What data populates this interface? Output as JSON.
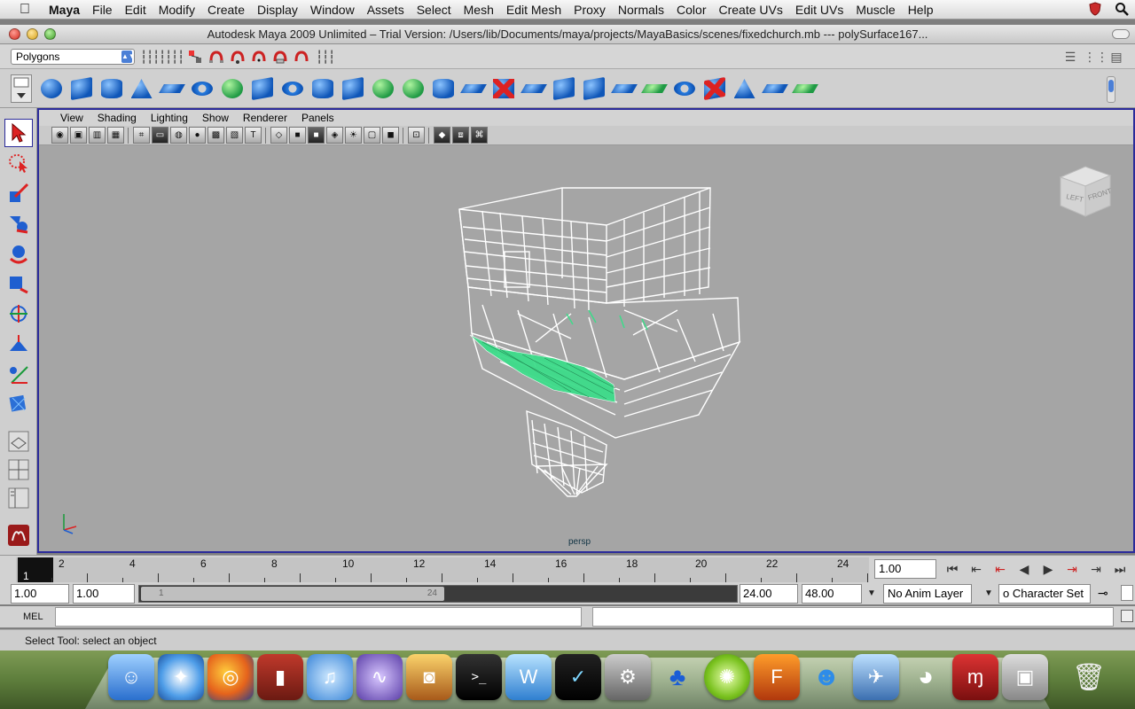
{
  "menubar": {
    "app": "Maya",
    "items": [
      "File",
      "Edit",
      "Modify",
      "Create",
      "Display",
      "Window",
      "Assets",
      "Select",
      "Mesh",
      "Edit Mesh",
      "Proxy",
      "Normals",
      "Color",
      "Create UVs",
      "Edit UVs",
      "Muscle",
      "Help"
    ]
  },
  "window": {
    "title": "Autodesk Maya 2009 Unlimited – Trial Version: /Users/lib/Documents/maya/projects/MayaBasics/scenes/fixedchurch.mb   ---   polySurface167..."
  },
  "statusline": {
    "menu_set": "Polygons"
  },
  "shelf": {
    "icons": [
      "poly-sphere-icon",
      "poly-cube-icon",
      "poly-cylinder-icon",
      "poly-cone-icon",
      "poly-plane-icon",
      "poly-torus-icon",
      "combine-icon",
      "separate-icon",
      "smooth-icon",
      "extrude-icon",
      "bridge-icon",
      "append-icon",
      "split-icon",
      "insert-edge-loop-icon",
      "offset-edge-loop-icon",
      "bevel-icon",
      "delete-edge-icon",
      "extract-icon",
      "merge-icon",
      "wedge-icon",
      "keep-faces-icon",
      "mirror-icon",
      "uv-editor-icon",
      "sculpt-icon",
      "plane-snap-icon",
      "quad-draw-icon"
    ]
  },
  "panel": {
    "menu": [
      "View",
      "Shading",
      "Lighting",
      "Show",
      "Renderer",
      "Panels"
    ],
    "camera_label": "persp",
    "viewcube": {
      "left": "LEFT",
      "front": "FRONT"
    }
  },
  "timeline": {
    "current_frame": "1",
    "labels": [
      "2",
      "4",
      "6",
      "8",
      "10",
      "12",
      "14",
      "16",
      "18",
      "20",
      "22",
      "24"
    ],
    "current_time": "1.00"
  },
  "range": {
    "start_time": "1.00",
    "playback_start": "1.00",
    "handle_start": "1",
    "handle_end": "24",
    "playback_end": "24.00",
    "end_time": "48.00",
    "anim_layer": "No Anim Layer",
    "character_set": "o Character Set"
  },
  "cmdline": {
    "label": "MEL"
  },
  "helpline": {
    "text": "Select Tool: select an object"
  },
  "colors": {
    "selection_green": "#3ddc8a",
    "panel_border": "#2b2b9a",
    "viewport_bg": "#a5a5a5"
  }
}
